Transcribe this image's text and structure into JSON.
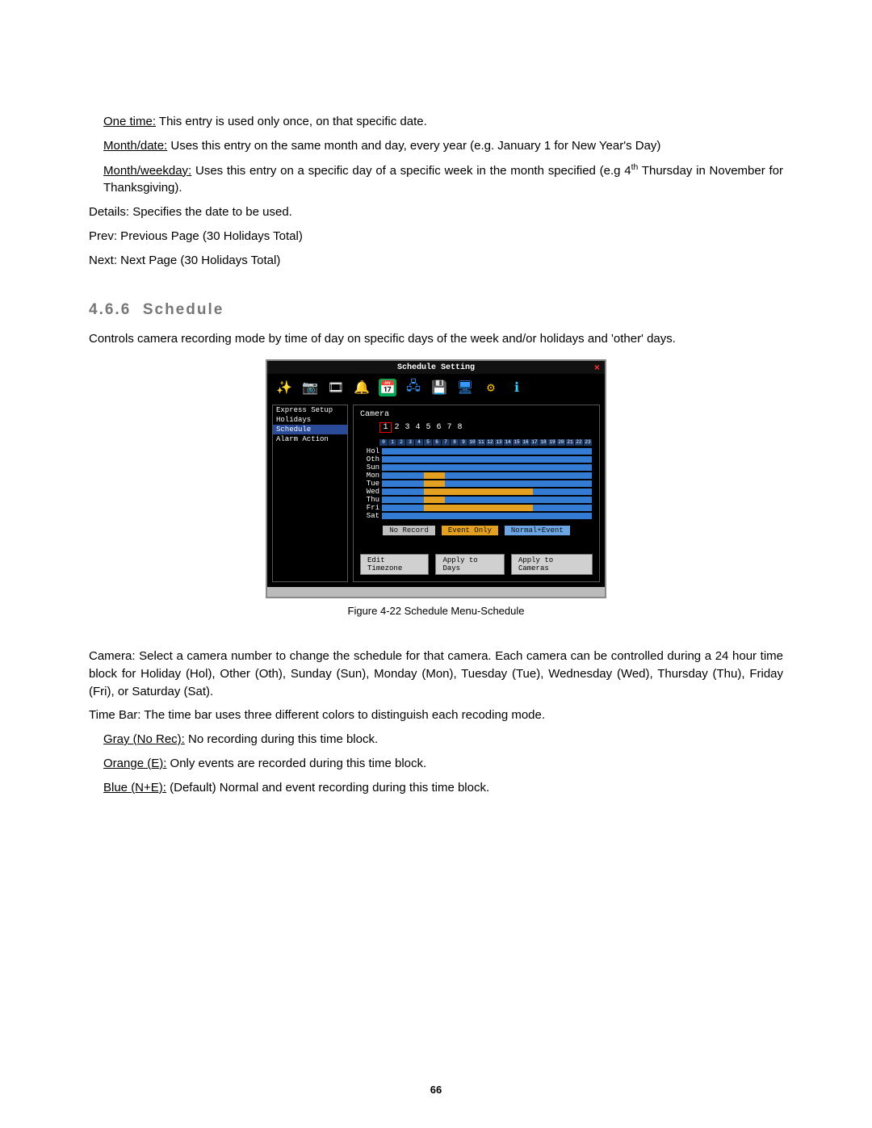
{
  "entries": {
    "one_time": {
      "label": "One time:",
      "text": " This entry is used only once, on that specific date."
    },
    "month_date": {
      "label": "Month/date:",
      "text": " Uses this entry on the same month and day, every year (e.g. January 1 for New Year's Day)"
    },
    "month_weekday": {
      "label": "Month/weekday:",
      "text_a": " Uses this entry on a specific day of a specific week in the month specified (e.g 4",
      "sup": "th",
      "text_b": " Thursday in November for Thanksgiving)."
    }
  },
  "lines": {
    "details": {
      "k": "Details:",
      "v": " Specifies the date to be used."
    },
    "prev": {
      "k": "Prev:",
      "v": " Previous Page (30 Holidays Total)"
    },
    "next": {
      "k": "Next:",
      "v": " Next Page (30 Holidays Total)"
    }
  },
  "heading": {
    "num": "4.6.6",
    "title": "Schedule"
  },
  "intro": "Controls camera recording mode by time of day on specific days of the week and/or holidays and 'other' days.",
  "shot": {
    "title": "Schedule Setting",
    "close": "×",
    "sidebar": [
      "Express Setup",
      "Holidays",
      "Schedule",
      "Alarm Action"
    ],
    "sidebar_selected": 2,
    "camera_label": "Camera",
    "camera_nums": [
      "1",
      "2",
      "3",
      "4",
      "5",
      "6",
      "7",
      "8"
    ],
    "camera_selected": 0,
    "hours": [
      "0",
      "1",
      "2",
      "3",
      "4",
      "5",
      "6",
      "7",
      "8",
      "9",
      "10",
      "11",
      "12",
      "13",
      "14",
      "15",
      "16",
      "17",
      "18",
      "19",
      "20",
      "21",
      "22",
      "23"
    ],
    "days": [
      "Hol",
      "Oth",
      "Sun",
      "Mon",
      "Tue",
      "Wed",
      "Thu",
      "Fri",
      "Sat"
    ],
    "legend": [
      "No Record",
      "Event Only",
      "Normal+Event"
    ],
    "buttons": [
      "Edit Timezone",
      "Apply to Days",
      "Apply to Cameras"
    ]
  },
  "caption": "Figure 4-22 Schedule Menu-Schedule",
  "camera_desc": {
    "k": "Camera:",
    "v": " Select a camera number to change the schedule for that camera. Each camera can be controlled during a 24 hour time block for Holiday (Hol), Other (Oth), Sunday (Sun), Monday (Mon), Tuesday (Tue), Wednesday (Wed), Thursday (Thu), Friday (Fri), or Saturday (Sat)."
  },
  "timebar": {
    "k": "Time Bar:",
    "v": " The time bar uses three different colors to distinguish each recoding mode."
  },
  "colors": {
    "gray": {
      "label": "Gray (No Rec):",
      "text": " No recording during this time block."
    },
    "orange": {
      "label": "Orange (E):",
      "text": " Only events are recorded during this time block."
    },
    "blue": {
      "label": "Blue (N+E):",
      "text": " (Default) Normal and event recording during this time block."
    }
  },
  "page_num": "66"
}
